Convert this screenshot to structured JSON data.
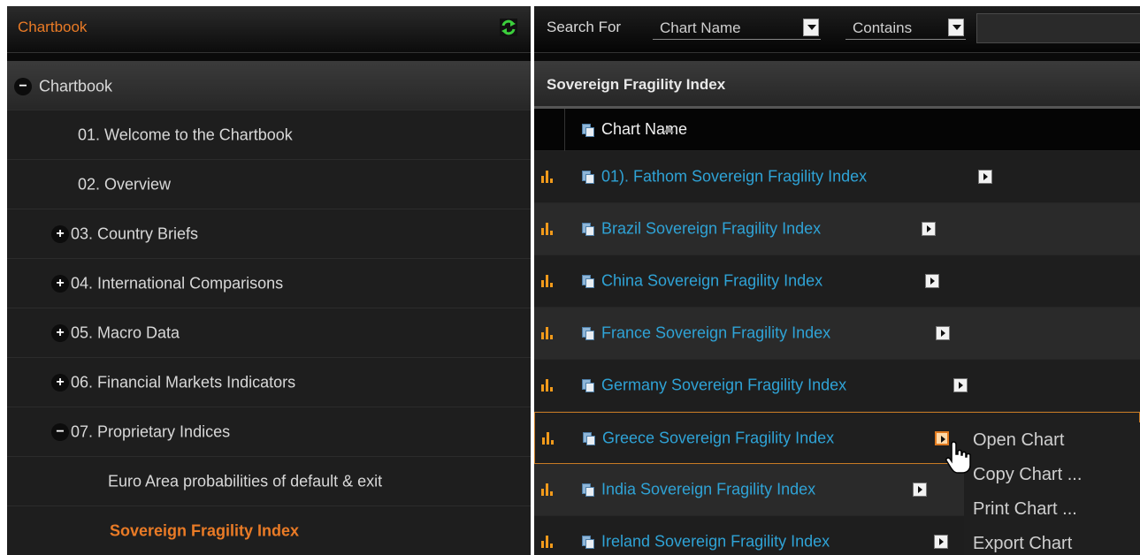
{
  "left_panel": {
    "title": "Chartbook",
    "refresh_icon": "refresh-icon",
    "tree": [
      {
        "label": "Chartbook",
        "toggle": "−",
        "level": 0
      },
      {
        "label": "01. Welcome to the Chartbook",
        "toggle": "",
        "level": 1
      },
      {
        "label": "02. Overview",
        "toggle": "",
        "level": 1
      },
      {
        "label": "03. Country Briefs",
        "toggle": "+",
        "level": 1
      },
      {
        "label": "04. International Comparisons",
        "toggle": "+",
        "level": 1
      },
      {
        "label": "05. Macro Data",
        "toggle": "+",
        "level": 1
      },
      {
        "label": "06. Financial Markets Indicators",
        "toggle": "+",
        "level": 1
      },
      {
        "label": "07. Proprietary Indices",
        "toggle": "−",
        "level": 1
      },
      {
        "label": "Euro Area probabilities of default & exit",
        "toggle": "",
        "level": 2
      },
      {
        "label": "Sovereign Fragility Index",
        "toggle": "",
        "level": 2,
        "active": true
      }
    ]
  },
  "search": {
    "label": "Search For",
    "field_value": "Chart Name",
    "operator_value": "Contains",
    "input_value": ""
  },
  "folder_title": "Sovereign Fragility Index",
  "table": {
    "column_header": "Chart Name",
    "sort": "ascending",
    "rows": [
      {
        "name": "01). Fathom Sovereign Fragility Index"
      },
      {
        "name": "Brazil Sovereign Fragility Index"
      },
      {
        "name": "China Sovereign Fragility Index"
      },
      {
        "name": "France Sovereign Fragility Index"
      },
      {
        "name": "Germany Sovereign Fragility Index"
      },
      {
        "name": "Greece Sovereign Fragility Index",
        "selected": true
      },
      {
        "name": "India Sovereign Fragility Index"
      },
      {
        "name": "Ireland Sovereign Fragility Index"
      }
    ]
  },
  "context_menu": {
    "items": [
      "Open Chart",
      "Copy Chart ...",
      "Print Chart ...",
      "Export Chart"
    ]
  },
  "colors": {
    "accent_orange": "#ea7b26",
    "link_blue": "#2fa3d6",
    "bar_icon": "#f19a1b"
  }
}
